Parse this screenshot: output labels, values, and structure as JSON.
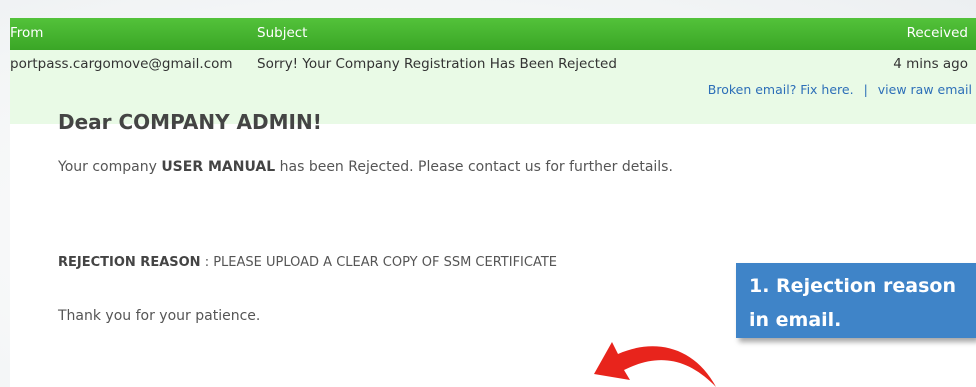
{
  "table": {
    "headers": {
      "from": "From",
      "subject": "Subject",
      "received": "Received"
    },
    "message": {
      "from": "portpass.cargomove@gmail.com",
      "subject": "Sorry! Your Company Registration Has Been Rejected",
      "received": "4 mins ago"
    },
    "links": {
      "fix": "Broken email? Fix here.",
      "separator": "|",
      "raw": "view raw email"
    }
  },
  "email": {
    "greeting": "Dear COMPANY ADMIN!",
    "para1_pre": "Your company ",
    "para1_bold": "USER MANUAL",
    "para1_post": " has been Rejected. Please contact us for further details.",
    "reason_label": "REJECTION REASON",
    "reason_text": " : PLEASE UPLOAD A CLEAR COPY OF SSM CERTIFICATE",
    "thanks": "Thank you for your patience."
  },
  "annotation": {
    "line1": "1. Rejection reason",
    "line2": "in email.",
    "color": "#3f84c8",
    "arrow_color": "#e8241c"
  },
  "colors": {
    "header_green": "#43b22f",
    "row_bg": "#e9fae6",
    "link_blue": "#2d6fb8"
  }
}
